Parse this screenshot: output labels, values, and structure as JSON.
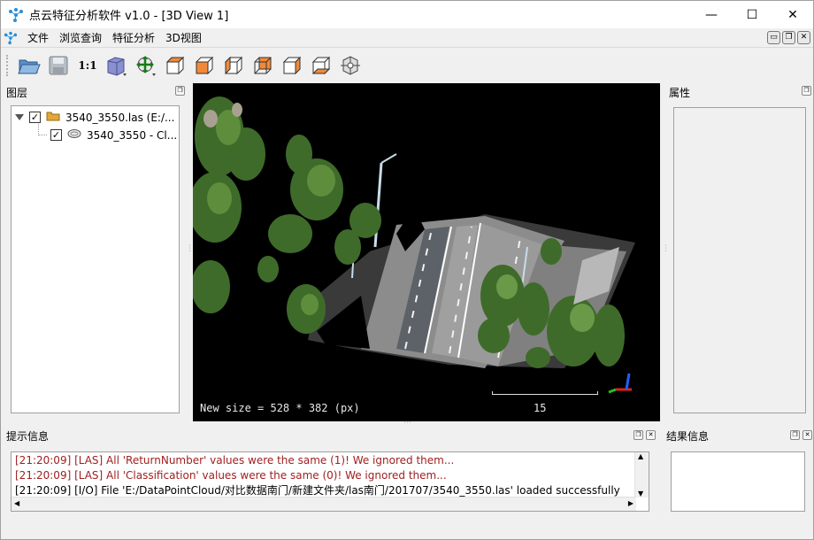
{
  "window": {
    "title": "点云特征分析软件 v1.0 - [3D View 1]",
    "minimize_glyph": "—",
    "maximize_glyph": "☐",
    "close_glyph": "✕"
  },
  "menu": {
    "items": [
      "文件",
      "浏览查询",
      "特征分析",
      "3D视图"
    ],
    "mdi_buttons": [
      "▭",
      "❐",
      "✕"
    ]
  },
  "toolbar": {
    "scale_label": "1:1",
    "icons": [
      "open-folder-icon",
      "save-icon",
      "zoom-1to1-icon",
      "display-cube-icon",
      "pan-cross-icon",
      "view-top-icon",
      "view-front-icon",
      "view-left-icon",
      "view-back-icon",
      "view-right-icon",
      "view-bottom-icon",
      "pivot-icon"
    ]
  },
  "layers_panel": {
    "title": "图层",
    "file_node": {
      "label": "3540_3550.las (E:/...",
      "checked": true
    },
    "cloud_node": {
      "label": "3540_3550 - Cl...",
      "checked": true
    }
  },
  "properties_panel": {
    "title": "属性"
  },
  "view3d": {
    "status": "New size = 528 * 382 (px)",
    "scale_value": "15"
  },
  "console_panel": {
    "title": "提示信息",
    "lines": [
      {
        "text": "[21:20:09] [LAS] All 'ReturnNumber' values were the same (1)! We ignored them...",
        "level": "warning"
      },
      {
        "text": "[21:20:09] [LAS] All 'Classification' values were the same (0)! We ignored them...",
        "level": "warning"
      },
      {
        "text": "[21:20:09] [I/O] File 'E:/DataPointCloud/对比数据南门/新建文件夹/las南门/201707/3540_3550.las' loaded successfully",
        "level": "info"
      }
    ]
  },
  "results_panel": {
    "title": "结果信息"
  },
  "colors": {
    "view_background": "#000000",
    "warning_text": "#a02020",
    "tree_green": "#3f6b2a",
    "road_gray": "#9a9a9a"
  }
}
